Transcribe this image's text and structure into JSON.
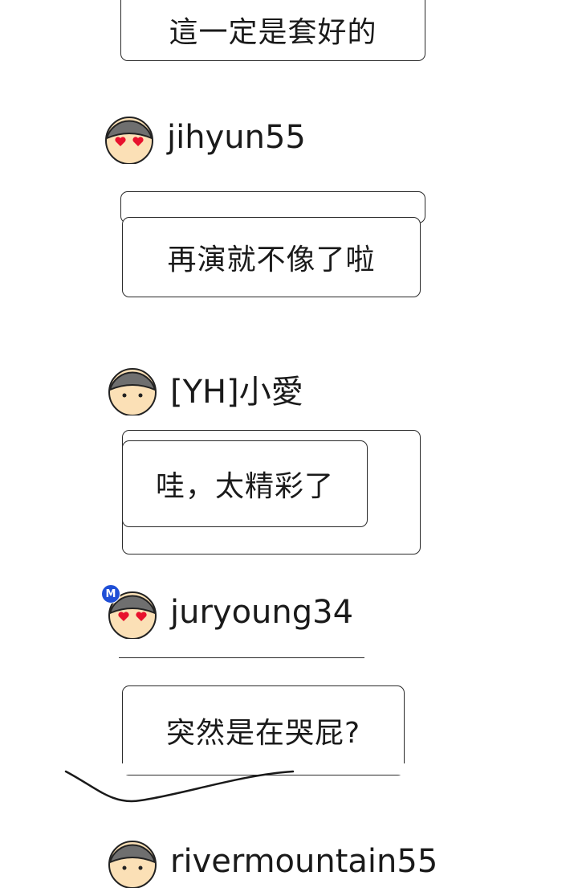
{
  "comments": [
    {
      "text": "這一定是套好的"
    },
    {
      "user": "jihyun55",
      "avatar": "heart-eyes-face",
      "text": "再演就不像了啦"
    },
    {
      "user": "[YH]小愛",
      "avatar": "dot-eyes-face",
      "text": "哇，太精彩了"
    },
    {
      "user": "juryoung34",
      "avatar": "heart-eyes-face",
      "badge": "M",
      "text": "突然是在哭屁?"
    },
    {
      "user": "rivermountain55",
      "avatar": "dot-eyes-face"
    }
  ],
  "colors": {
    "face": "#fbe0b6",
    "hair": "#6f6f6f",
    "heart": "#e8112d",
    "badge": "#1f4fd6"
  }
}
